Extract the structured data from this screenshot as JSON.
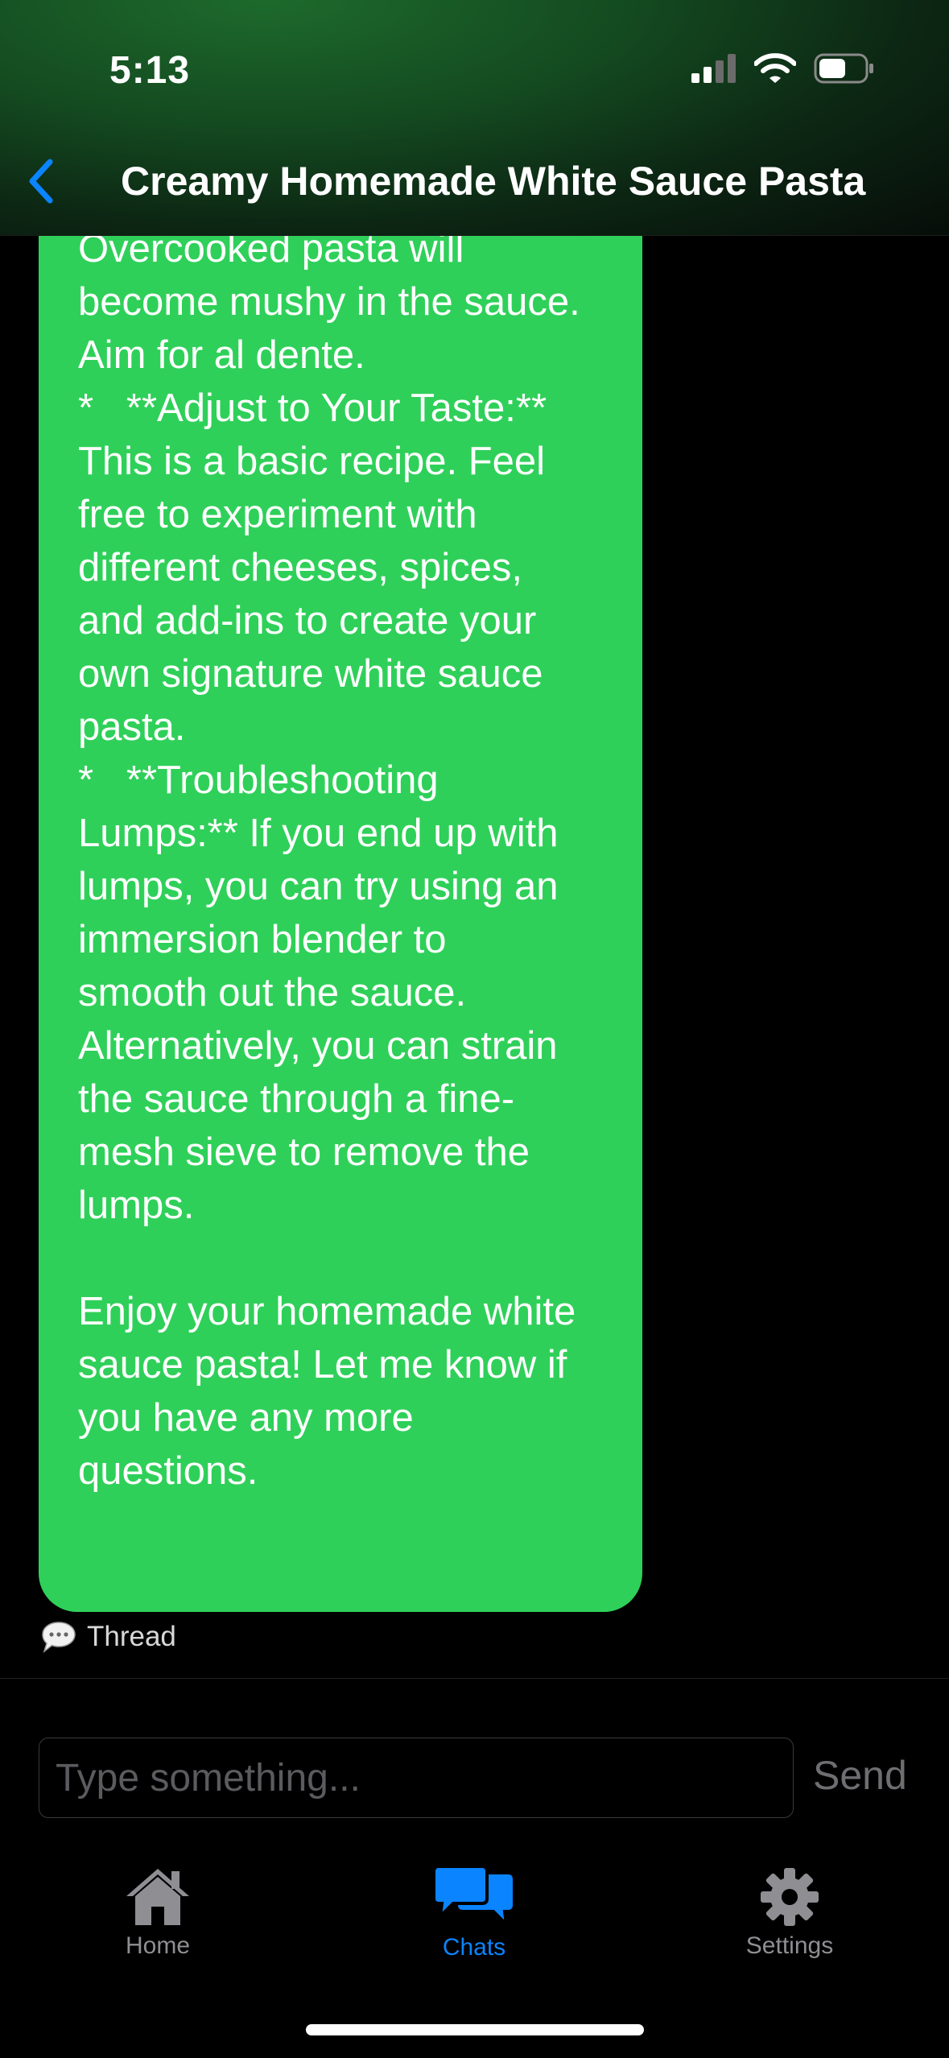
{
  "status_bar": {
    "time": "5:13"
  },
  "header": {
    "title": "Creamy Homemade White Sauce Pasta"
  },
  "message": {
    "text": "        Don't Overcook:\nOvercooked pasta will\nbecome mushy in the sauce.\nAim for al dente.\n*   **Adjust to Your Taste:**\nThis is a basic recipe. Feel\nfree to experiment with\ndifferent cheeses, spices,\nand add-ins to create your\nown signature white sauce\npasta.\n*   **Troubleshooting\nLumps:** If you end up with\nlumps, you can try using an\nimmersion blender to\nsmooth out the sauce.\nAlternatively, you can strain\nthe sauce through a fine-\nmesh sieve to remove the\nlumps.\n\nEnjoy your homemade white\nsauce pasta! Let me know if\nyou have any more\nquestions.",
    "thread_label": "Thread",
    "bubble_color": "#2fd059"
  },
  "composer": {
    "placeholder": "Type something...",
    "send_label": "Send"
  },
  "tabs": [
    {
      "label": "Home",
      "icon": "home-icon",
      "active": false
    },
    {
      "label": "Chats",
      "icon": "chat-bubbles-icon",
      "active": true
    },
    {
      "label": "Settings",
      "icon": "gear-icon",
      "active": false
    }
  ],
  "colors": {
    "accent": "#0a84ff",
    "inactive_tab": "#8e8e93"
  }
}
